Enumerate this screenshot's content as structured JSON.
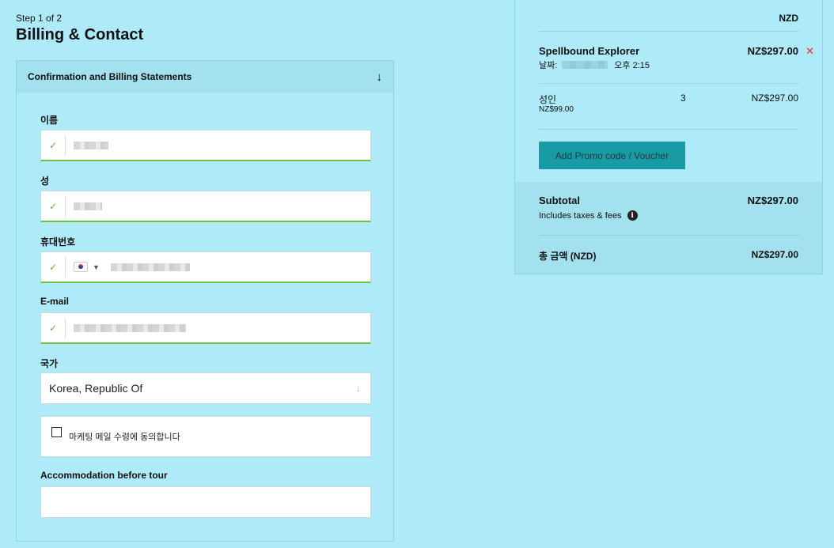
{
  "header": {
    "step": "Step 1 of 2",
    "title": "Billing & Contact"
  },
  "form": {
    "accordion_title": "Confirmation and Billing Statements",
    "first_name_label": "이름",
    "last_name_label": "성",
    "phone_label": "휴대번호",
    "email_label": "E-mail",
    "country_label": "국가",
    "country_value": "Korea, Republic Of",
    "marketing_label": "마케팅 메일 수령에 동의합니다",
    "accommodation_label": "Accommodation before tour",
    "accommodation_value": ""
  },
  "summary": {
    "currency": "NZD",
    "product_name": "Spellbound Explorer",
    "product_price": "NZ$297.00",
    "date_label": "날짜:",
    "time": "오후 2:15",
    "ticket_type": "성인",
    "ticket_unit_price": "NZ$99.00",
    "ticket_qty": "3",
    "ticket_total": "NZ$297.00",
    "promo_button": "Add Promo code / Voucher",
    "subtotal_label": "Subtotal",
    "subtotal_value": "NZ$297.00",
    "taxes_note": "Includes taxes & fees",
    "total_label": "총 금액 (NZD)",
    "total_value": "NZ$297.00"
  },
  "icons": {
    "remove": "close-icon",
    "check": "check-icon",
    "accordion": "arrow-down-icon",
    "info": "info-icon"
  },
  "colors": {
    "background": "#afeaf8",
    "accent_button": "#1a9aa5",
    "valid_green": "#6cc04a",
    "remove_red": "#e03030"
  }
}
